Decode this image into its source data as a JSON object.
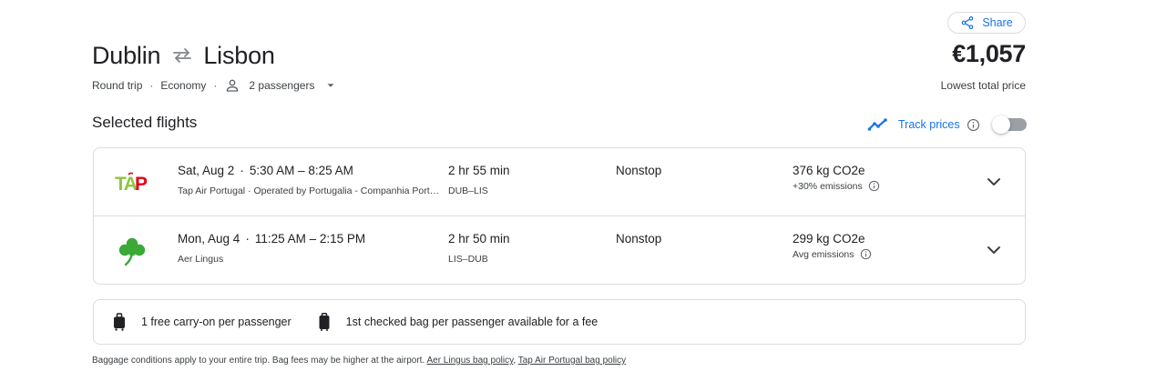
{
  "share": {
    "label": "Share",
    "icon": "share-icon"
  },
  "route": {
    "origin": "Dublin",
    "destination": "Lisbon",
    "swap_icon": "swap-arrows-icon"
  },
  "price": {
    "amount": "€1,057",
    "label": "Lowest total price"
  },
  "trip": {
    "type": "Round trip",
    "cabin": "Economy",
    "passengers": "2 passengers",
    "separator": "·"
  },
  "section": {
    "title": "Selected flights"
  },
  "track": {
    "label": "Track prices",
    "enabled": false
  },
  "flights": [
    {
      "airline_logo": "TAP",
      "date": "Sat, Aug 2",
      "sep": "·",
      "times": "5:30 AM – 8:25 AM",
      "airline": "Tap Air Portugal",
      "operated": "· Operated by Portugalia - Companhia Portuguesa de Transportes Aereos",
      "duration": "2 hr 55 min",
      "airports": "DUB–LIS",
      "stops": "Nonstop",
      "co2": "376 kg CO2e",
      "emissions": "+30% emissions"
    },
    {
      "airline_logo": "shamrock",
      "date": "Mon, Aug 4",
      "sep": "·",
      "times": "11:25 AM – 2:15 PM",
      "airline": "Aer Lingus",
      "operated": "",
      "duration": "2 hr 50 min",
      "airports": "LIS–DUB",
      "stops": "Nonstop",
      "co2": "299 kg CO2e",
      "emissions": "Avg emissions"
    }
  ],
  "bags": [
    {
      "icon": "carry-on-bag-icon",
      "label": "1 free carry-on per passenger"
    },
    {
      "icon": "checked-bag-icon",
      "label": "1st checked bag per passenger available for a fee"
    }
  ],
  "footer": {
    "text": "Baggage conditions apply to your entire trip. Bag fees may be higher at the airport.",
    "link1": "Aer Lingus bag policy",
    "comma": ",",
    "link2": "Tap Air Portugal bag policy"
  },
  "colors": {
    "accent": "#1a73e8",
    "border": "#dadce0",
    "tap_green": "#8dc63f",
    "tap_red": "#e2001a",
    "aer_green": "#3aa935"
  }
}
